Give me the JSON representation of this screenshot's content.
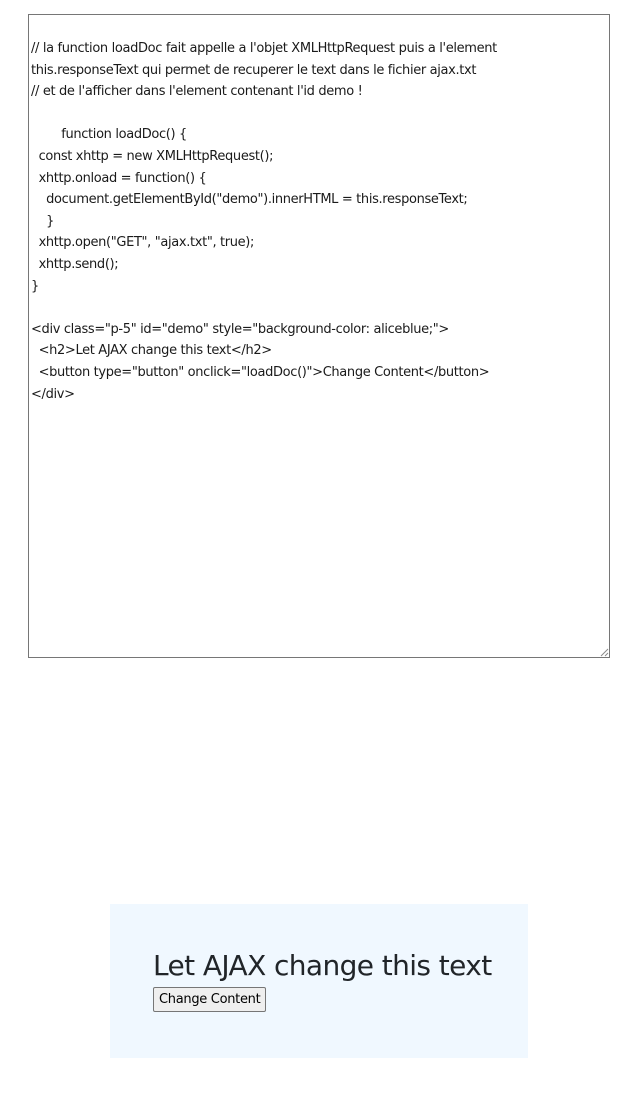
{
  "editor": {
    "content": "// la function loadDoc fait appelle a l'objet XMLHttpRequest puis a l'element\nthis.responseText qui permet de recuperer le text dans le fichier ajax.txt\n// et de l'afficher dans l'element contenant l'id demo !\n\n        function loadDoc() {\n  const xhttp = new XMLHttpRequest();\n  xhttp.onload = function() {\n    document.getElementById(\"demo\").innerHTML = this.responseText;\n    }\n  xhttp.open(\"GET\", \"ajax.txt\", true);\n  xhttp.send();\n}\n\n<div class=\"p-5\" id=\"demo\" style=\"background-color: aliceblue;\">\n  <h2>Let AJAX change this text</h2>\n  <button type=\"button\" onclick=\"loadDoc()\">Change Content</button>\n</div>"
  },
  "demo": {
    "title": "Let AJAX change this text",
    "button_label": "Change Content",
    "background_color": "#f0f8ff"
  }
}
